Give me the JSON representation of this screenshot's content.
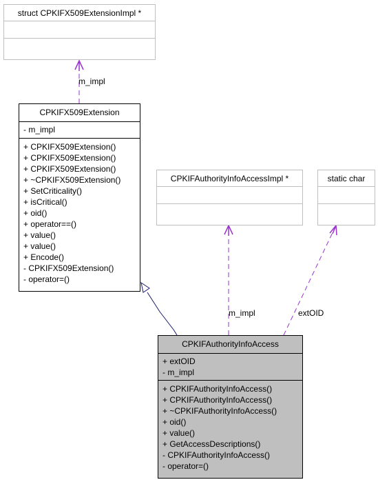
{
  "nodes": {
    "ext_impl": {
      "title": "struct CPKIFX509ExtensionImpl *",
      "attributes": [],
      "methods": []
    },
    "x509ext": {
      "title": "CPKIFX509Extension",
      "attributes": [
        "- m_impl"
      ],
      "methods": [
        "+ CPKIFX509Extension()",
        "+ CPKIFX509Extension()",
        "+ CPKIFX509Extension()",
        "+ ~CPKIFX509Extension()",
        "+ SetCriticality()",
        "+ isCritical()",
        "+ oid()",
        "+ operator==()",
        "+ value()",
        "+ value()",
        "+ Encode()",
        "- CPKIFX509Extension()",
        "- operator=()"
      ]
    },
    "aia_impl": {
      "title": "CPKIFAuthorityInfoAccessImpl *",
      "attributes": [],
      "methods": []
    },
    "static_char": {
      "title": "static char",
      "attributes": [],
      "methods": []
    },
    "aia": {
      "title": "CPKIFAuthorityInfoAccess",
      "attributes": [
        "+ extOID",
        "- m_impl"
      ],
      "methods": [
        "+ CPKIFAuthorityInfoAccess()",
        "+ CPKIFAuthorityInfoAccess()",
        "+ ~CPKIFAuthorityInfoAccess()",
        "+ oid()",
        "+ value()",
        "+ GetAccessDescriptions()",
        "- CPKIFAuthorityInfoAccess()",
        "- operator=()"
      ]
    }
  },
  "edges": {
    "x509ext_to_impl": {
      "label": "m_impl",
      "kind": "usage"
    },
    "aia_to_impl": {
      "label": "m_impl",
      "kind": "usage"
    },
    "aia_to_char": {
      "label": "extOID",
      "kind": "usage"
    },
    "aia_inherits_x509ext": {
      "label": "",
      "kind": "inheritance"
    }
  },
  "colors": {
    "usage_edge": "#9a32cd",
    "inheritance_edge": "#191970",
    "grey_border": "#bfbfbf",
    "highlight_fill": "#bfbfbf"
  }
}
